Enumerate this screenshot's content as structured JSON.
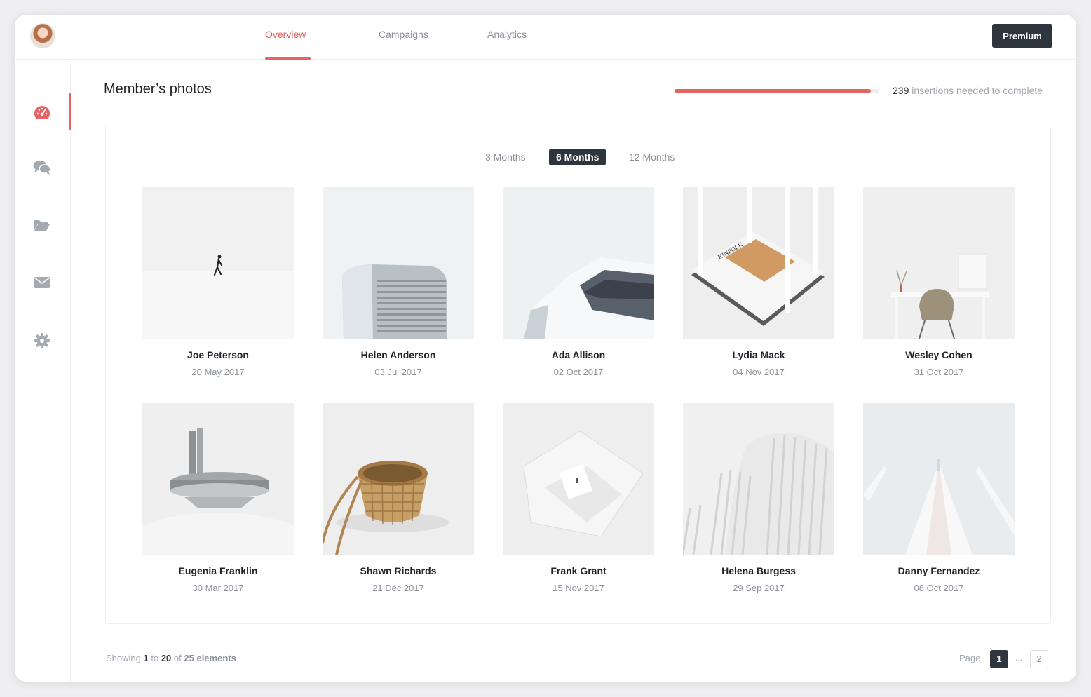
{
  "header": {
    "tabs": [
      {
        "label": "Overview"
      },
      {
        "label": "Campaigns"
      },
      {
        "label": "Analytics"
      }
    ],
    "premium_label": "Premium"
  },
  "sidebar": {
    "items": [
      {
        "icon": "dashboard-icon",
        "active": true
      },
      {
        "icon": "chat-icon"
      },
      {
        "icon": "folder-icon"
      },
      {
        "icon": "mail-icon"
      },
      {
        "icon": "gear-icon"
      }
    ]
  },
  "main": {
    "title": "Member’s photos",
    "progress": {
      "count": "239",
      "text": "insertions needed to complete",
      "fill_fraction": 0.96
    },
    "ranges": [
      {
        "label": "3 Months"
      },
      {
        "label": "6 Months",
        "active": true
      },
      {
        "label": "12 Months"
      }
    ],
    "photos": [
      {
        "name": "Joe Peterson",
        "date": "20 May 2017",
        "image": "person-walking-in-snow"
      },
      {
        "name": "Helen Anderson",
        "date": "03 Jul 2017",
        "image": "curved-glass-skyscraper"
      },
      {
        "name": "Ada Allison",
        "date": "02 Oct 2017",
        "image": "white-building-corner"
      },
      {
        "name": "Lydia Mack",
        "date": "04 Nov 2017",
        "image": "kinfolk-magazines"
      },
      {
        "name": "Wesley Cohen",
        "date": "31 Oct 2017",
        "image": "desk-and-chair"
      },
      {
        "name": "Eugenia Franklin",
        "date": "30 Mar 2017",
        "image": "concrete-monument"
      },
      {
        "name": "Shawn Richards",
        "date": "21 Dec 2017",
        "image": "wicker-basket-bag"
      },
      {
        "name": "Frank Grant",
        "date": "15 Nov 2017",
        "image": "plastic-bag"
      },
      {
        "name": "Helena Burgess",
        "date": "29 Sep 2017",
        "image": "white-architecture-ribs"
      },
      {
        "name": "Danny Fernandez",
        "date": "08 Oct 2017",
        "image": "white-spires"
      }
    ],
    "pagination": {
      "showing": "Showing",
      "from": "1",
      "to_word": "to",
      "to": "20",
      "of_word": "of",
      "total": "25 elements",
      "page_label": "Page",
      "current": "1",
      "ellipsis": "...",
      "next": "2"
    }
  },
  "colors": {
    "accent": "#e46464",
    "dark": "#2f353d",
    "muted": "#8b9099"
  }
}
